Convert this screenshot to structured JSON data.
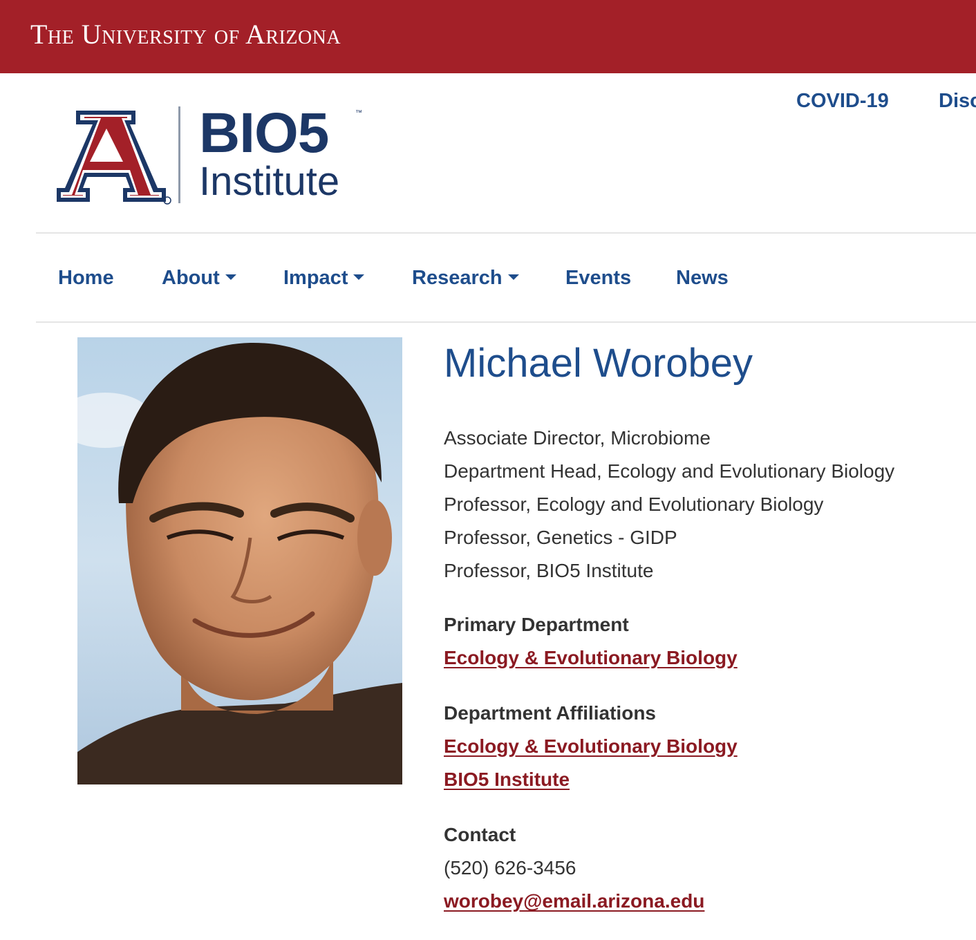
{
  "university_bar": {
    "wordmark": "The University of Arizona"
  },
  "logo": {
    "primary": "BIO5",
    "secondary": "Institute",
    "trademark": "™",
    "brand_red": "#a32028",
    "brand_navy": "#1c3766"
  },
  "utility_nav": {
    "items": [
      {
        "label": "COVID-19"
      },
      {
        "label": "Disc"
      }
    ]
  },
  "main_nav": {
    "items": [
      {
        "label": "Home",
        "has_dropdown": false
      },
      {
        "label": "About",
        "has_dropdown": true
      },
      {
        "label": "Impact",
        "has_dropdown": true
      },
      {
        "label": "Research",
        "has_dropdown": true
      },
      {
        "label": "Events",
        "has_dropdown": false
      },
      {
        "label": "News",
        "has_dropdown": false
      }
    ]
  },
  "profile": {
    "name": "Michael Worobey",
    "titles": [
      "Associate Director, Microbiome",
      "Department Head, Ecology and Evolutionary Biology",
      "Professor, Ecology and Evolutionary Biology",
      "Professor, Genetics - GIDP",
      "Professor, BIO5 Institute"
    ],
    "primary_department": {
      "heading": "Primary Department",
      "links": [
        "Ecology & Evolutionary Biology"
      ]
    },
    "department_affiliations": {
      "heading": "Department Affiliations",
      "links": [
        "Ecology & Evolutionary Biology",
        "BIO5 Institute"
      ]
    },
    "contact": {
      "heading": "Contact",
      "phone": "(520) 626-3456",
      "email": "worobey@email.arizona.edu"
    }
  },
  "colors": {
    "link_blue": "#1e4d8c",
    "link_red": "#8b1a22",
    "body_text": "#333333"
  }
}
